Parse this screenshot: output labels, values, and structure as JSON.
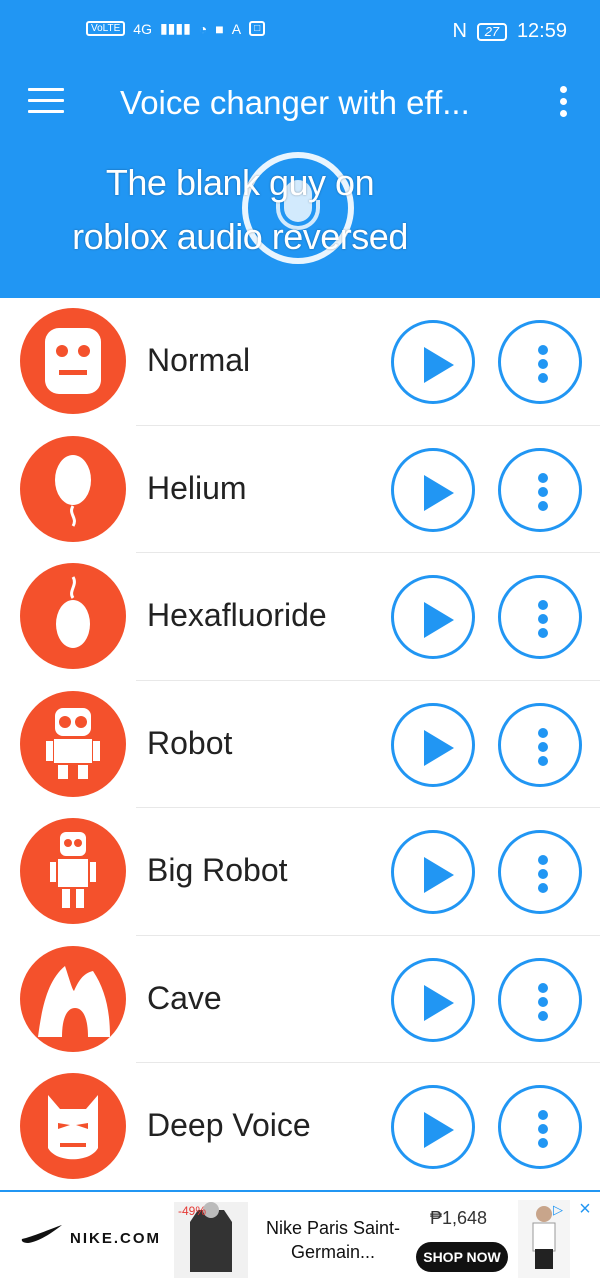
{
  "status_bar": {
    "left_indicators": [
      "VoLTE",
      "4G",
      "signal-icon",
      "wifi-icon",
      "camera-icon",
      "A",
      "app-icon"
    ],
    "battery": "27",
    "time": "12:59"
  },
  "toolbar": {
    "title": "Voice changer with eff...",
    "menu_icon": "hamburger-menu-icon",
    "overflow_icon": "overflow-menu-icon"
  },
  "record": {
    "icon": "microphone-icon"
  },
  "caption": {
    "line1": "The blank guy on",
    "line2": "roblox audio reversed"
  },
  "effects": [
    {
      "label": "Normal",
      "icon": "robot-face-icon"
    },
    {
      "label": "Helium",
      "icon": "balloon-icon"
    },
    {
      "label": "Hexafluoride",
      "icon": "heavy-balloon-icon"
    },
    {
      "label": "Robot",
      "icon": "robot-icon"
    },
    {
      "label": "Big Robot",
      "icon": "big-robot-icon"
    },
    {
      "label": "Cave",
      "icon": "cave-icon"
    },
    {
      "label": "Deep Voice",
      "icon": "mask-icon"
    }
  ],
  "ad": {
    "brand": "NIKE.COM",
    "discount": "-49%",
    "title": "Nike Paris Saint-Germain...",
    "price": "₱1,648",
    "cta": "SHOP NOW"
  },
  "colors": {
    "primary": "#2196f3",
    "accent": "#f4512c",
    "text": "#222222"
  }
}
